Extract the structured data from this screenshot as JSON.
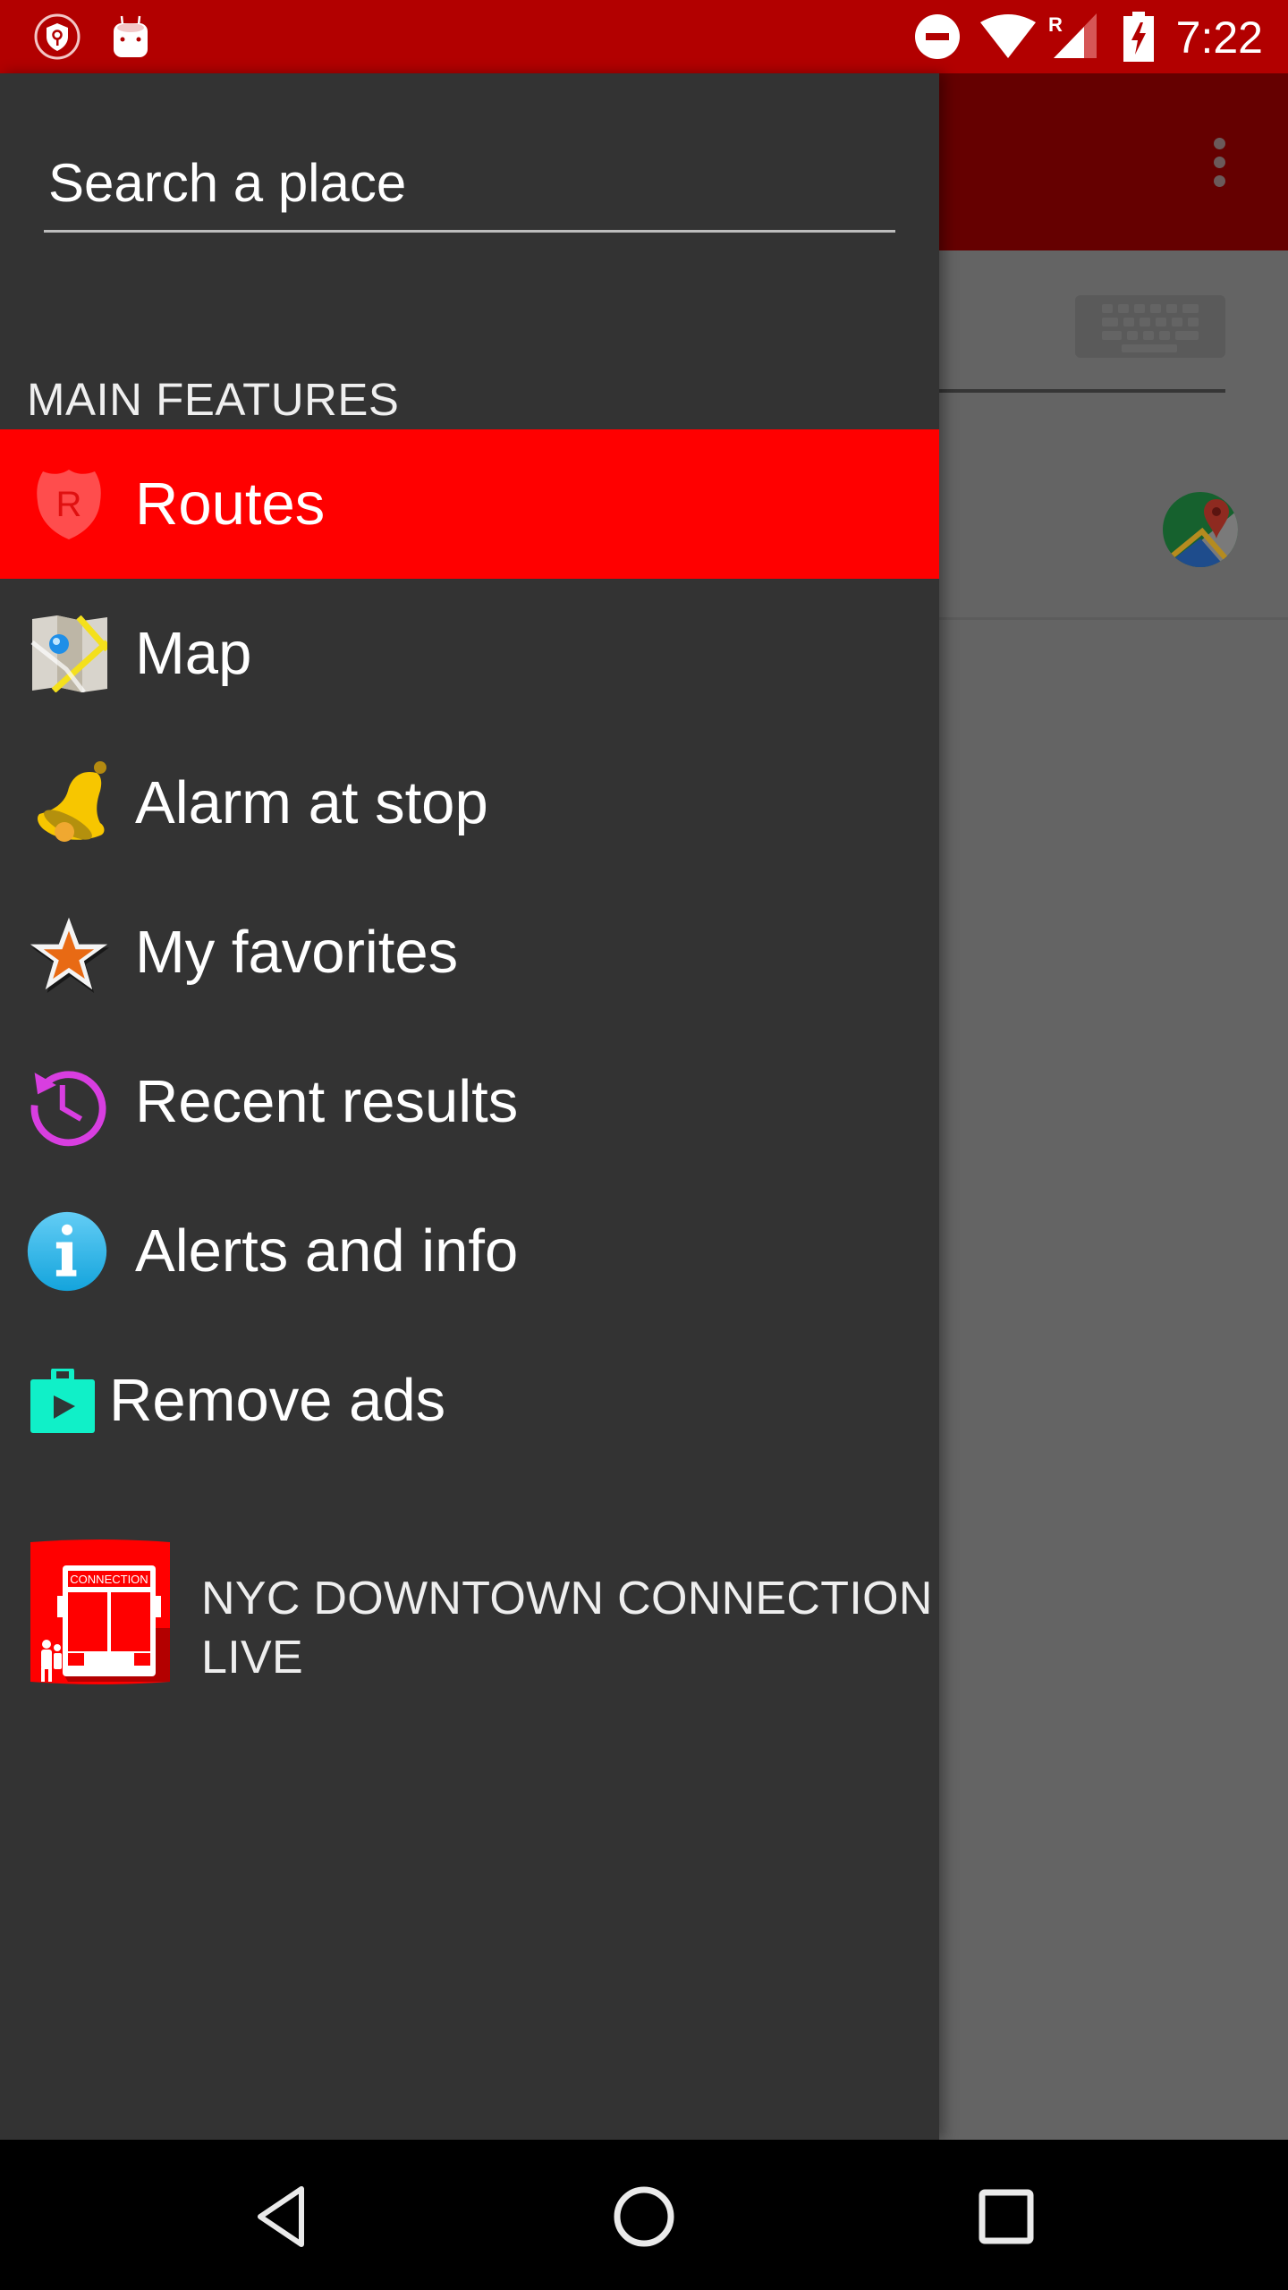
{
  "status_bar": {
    "time": "7:22",
    "left_icons": [
      "vpn-key-shield-icon",
      "android-debug-icon"
    ],
    "right_icons": [
      "do-not-disturb-icon",
      "wifi-icon",
      "signal-roaming-icon",
      "battery-charging-icon"
    ],
    "roaming_label": "R",
    "color": "#B20000"
  },
  "drawer": {
    "search": {
      "placeholder": "Search a place",
      "value": ""
    },
    "section_header": "MAIN FEATURES",
    "items": [
      {
        "label": "Routes",
        "icon": "route-shield-icon",
        "active": true
      },
      {
        "label": "Map",
        "icon": "map-icon",
        "active": false
      },
      {
        "label": "Alarm at stop",
        "icon": "bell-icon",
        "active": false
      },
      {
        "label": "My favorites",
        "icon": "star-icon",
        "active": false
      },
      {
        "label": "Recent results",
        "icon": "history-icon",
        "active": false
      },
      {
        "label": "Alerts and info",
        "icon": "info-icon",
        "active": false
      },
      {
        "label": "Remove ads",
        "icon": "play-store-bag-icon",
        "active": false
      }
    ],
    "promo": {
      "line1": "NYC DOWNTOWN CONNECTION",
      "line2": "LIVE",
      "logo_text": "CONNECTION",
      "icon": "bus-logo-icon"
    },
    "active_color": "#FF0000",
    "background_color": "#333333"
  },
  "background_app": {
    "toolbar_color": "#B20000",
    "overflow_icon": "more-vert-icon",
    "keyboard_icon": "keyboard-icon",
    "maps_icon": "google-maps-icon"
  },
  "nav_bar": {
    "buttons": [
      "back-icon",
      "home-icon",
      "recents-icon"
    ]
  }
}
